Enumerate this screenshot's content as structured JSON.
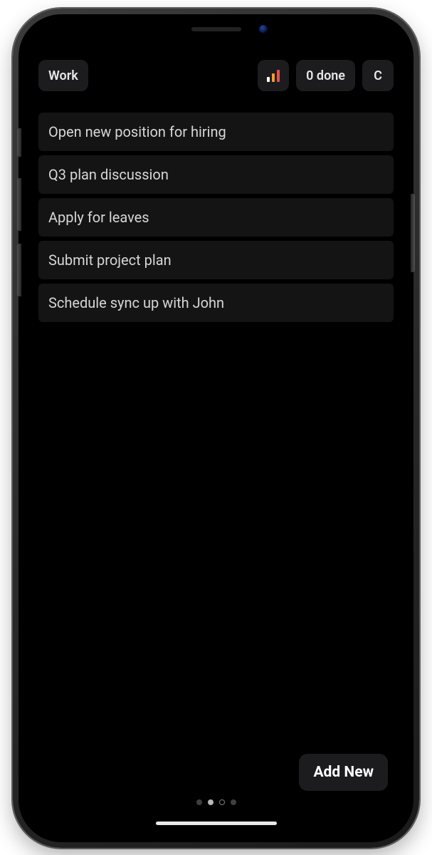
{
  "header": {
    "category_label": "Work",
    "done_label": "0 done",
    "clear_label": "C"
  },
  "tasks": [
    {
      "title": "Open new position for hiring"
    },
    {
      "title": "Q3 plan discussion"
    },
    {
      "title": "Apply for leaves"
    },
    {
      "title": "Submit project plan"
    },
    {
      "title": "Schedule sync up with John"
    }
  ],
  "footer": {
    "add_new_label": "Add New"
  },
  "pagination": {
    "total": 4,
    "current_index": 2
  }
}
